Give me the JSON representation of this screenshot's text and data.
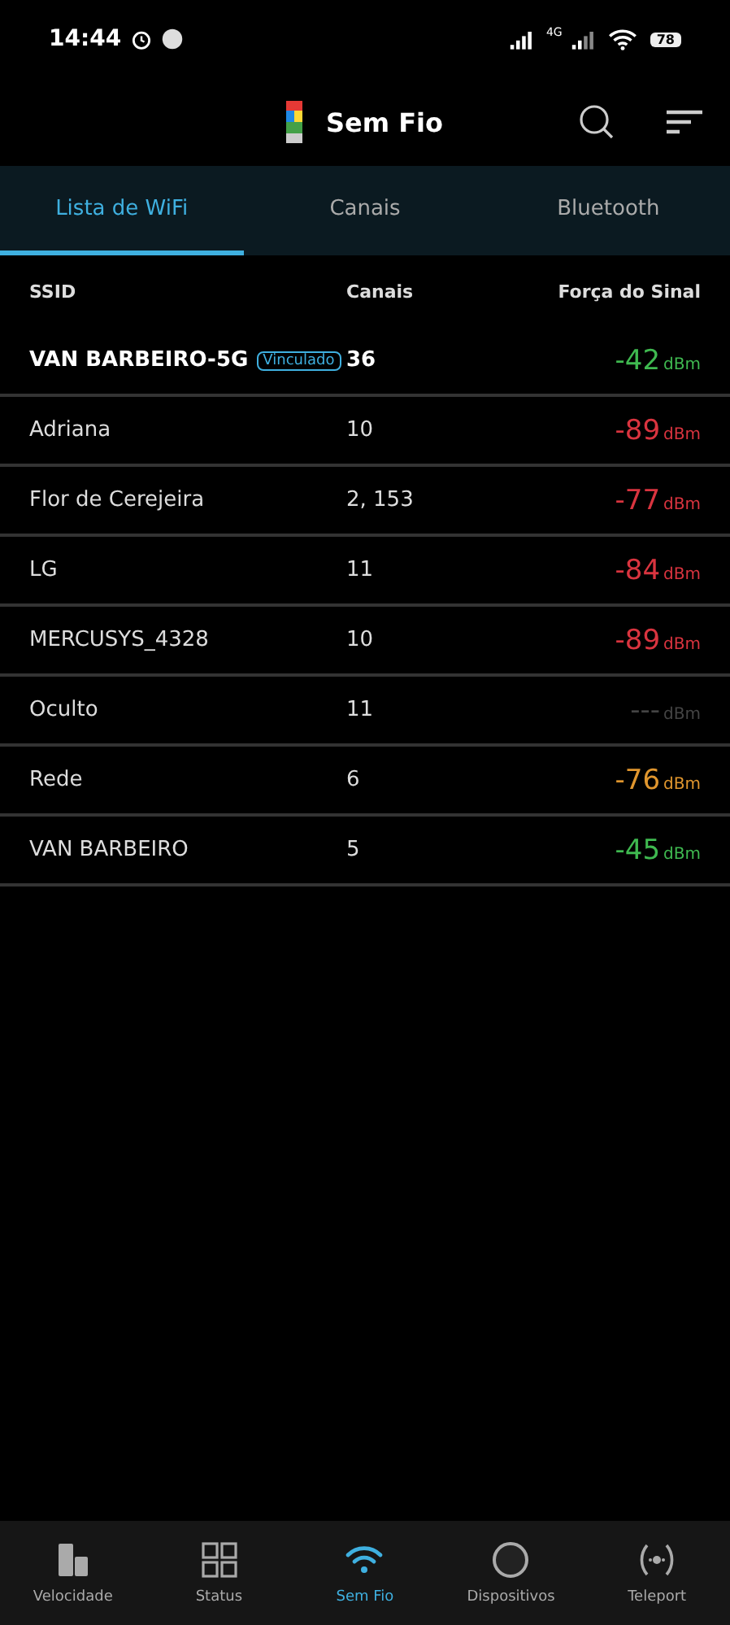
{
  "status_bar": {
    "time": "14:44",
    "network": "4G",
    "battery": "78"
  },
  "header": {
    "title": "Sem Fio"
  },
  "tabs": [
    {
      "label": "Lista de WiFi",
      "selected": true
    },
    {
      "label": "Canais",
      "selected": false
    },
    {
      "label": "Bluetooth",
      "selected": false
    }
  ],
  "table": {
    "columns": [
      "SSID",
      "Canais",
      "Força do Sinal"
    ],
    "rows": [
      {
        "ssid": "VAN BARBEIRO-5G",
        "connected": true,
        "badge": "Vinculado",
        "channels": "36",
        "signal": "-42",
        "unit": "dBm",
        "color": "#3fb950"
      },
      {
        "ssid": "Adriana",
        "connected": false,
        "channels": "10",
        "signal": "-89",
        "unit": "dBm",
        "color": "#d9343f"
      },
      {
        "ssid": "Flor de Cerejeira",
        "connected": false,
        "channels": "2, 153",
        "signal": "-77",
        "unit": "dBm",
        "color": "#d9343f"
      },
      {
        "ssid": "LG",
        "connected": false,
        "channels": "11",
        "signal": "-84",
        "unit": "dBm",
        "color": "#d9343f"
      },
      {
        "ssid": "MERCUSYS_4328",
        "connected": false,
        "channels": "10",
        "signal": "-89",
        "unit": "dBm",
        "color": "#d9343f"
      },
      {
        "ssid": "Oculto",
        "connected": false,
        "channels": "11",
        "signal": "---",
        "unit": "dBm",
        "color": "#444444"
      },
      {
        "ssid": "Rede",
        "connected": false,
        "channels": "6",
        "signal": "-76",
        "unit": "dBm",
        "color": "#e0962e"
      },
      {
        "ssid": "VAN BARBEIRO",
        "connected": false,
        "channels": "5",
        "signal": "-45",
        "unit": "dBm",
        "color": "#3fb950"
      }
    ]
  },
  "bottom_nav": [
    {
      "kind": "speed",
      "label": "Velocidade",
      "selected": false
    },
    {
      "kind": "status",
      "label": "Status",
      "selected": false
    },
    {
      "kind": "wifi",
      "label": "Sem Fio",
      "selected": true
    },
    {
      "kind": "devices",
      "label": "Dispositivos",
      "selected": false
    },
    {
      "kind": "teleport",
      "label": "Teleport",
      "selected": false
    }
  ]
}
